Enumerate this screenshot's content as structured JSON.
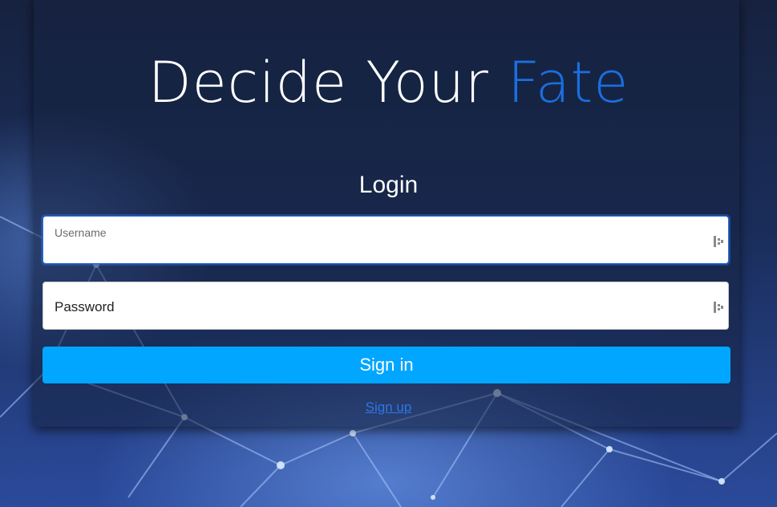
{
  "hero": {
    "title_main": "Decide Your ",
    "title_accent": "Fate"
  },
  "login": {
    "heading": "Login",
    "username": {
      "label": "Username",
      "value": ""
    },
    "password": {
      "label": "Password",
      "value": ""
    },
    "signin_label": "Sign in",
    "signup_label": "Sign up"
  },
  "colors": {
    "accent": "#1a6fe0",
    "button": "#00a6ff",
    "link": "#2b78e4",
    "focus_border": "#2c6cdb"
  },
  "icons": {
    "field_icon": "password-manager-icon"
  }
}
